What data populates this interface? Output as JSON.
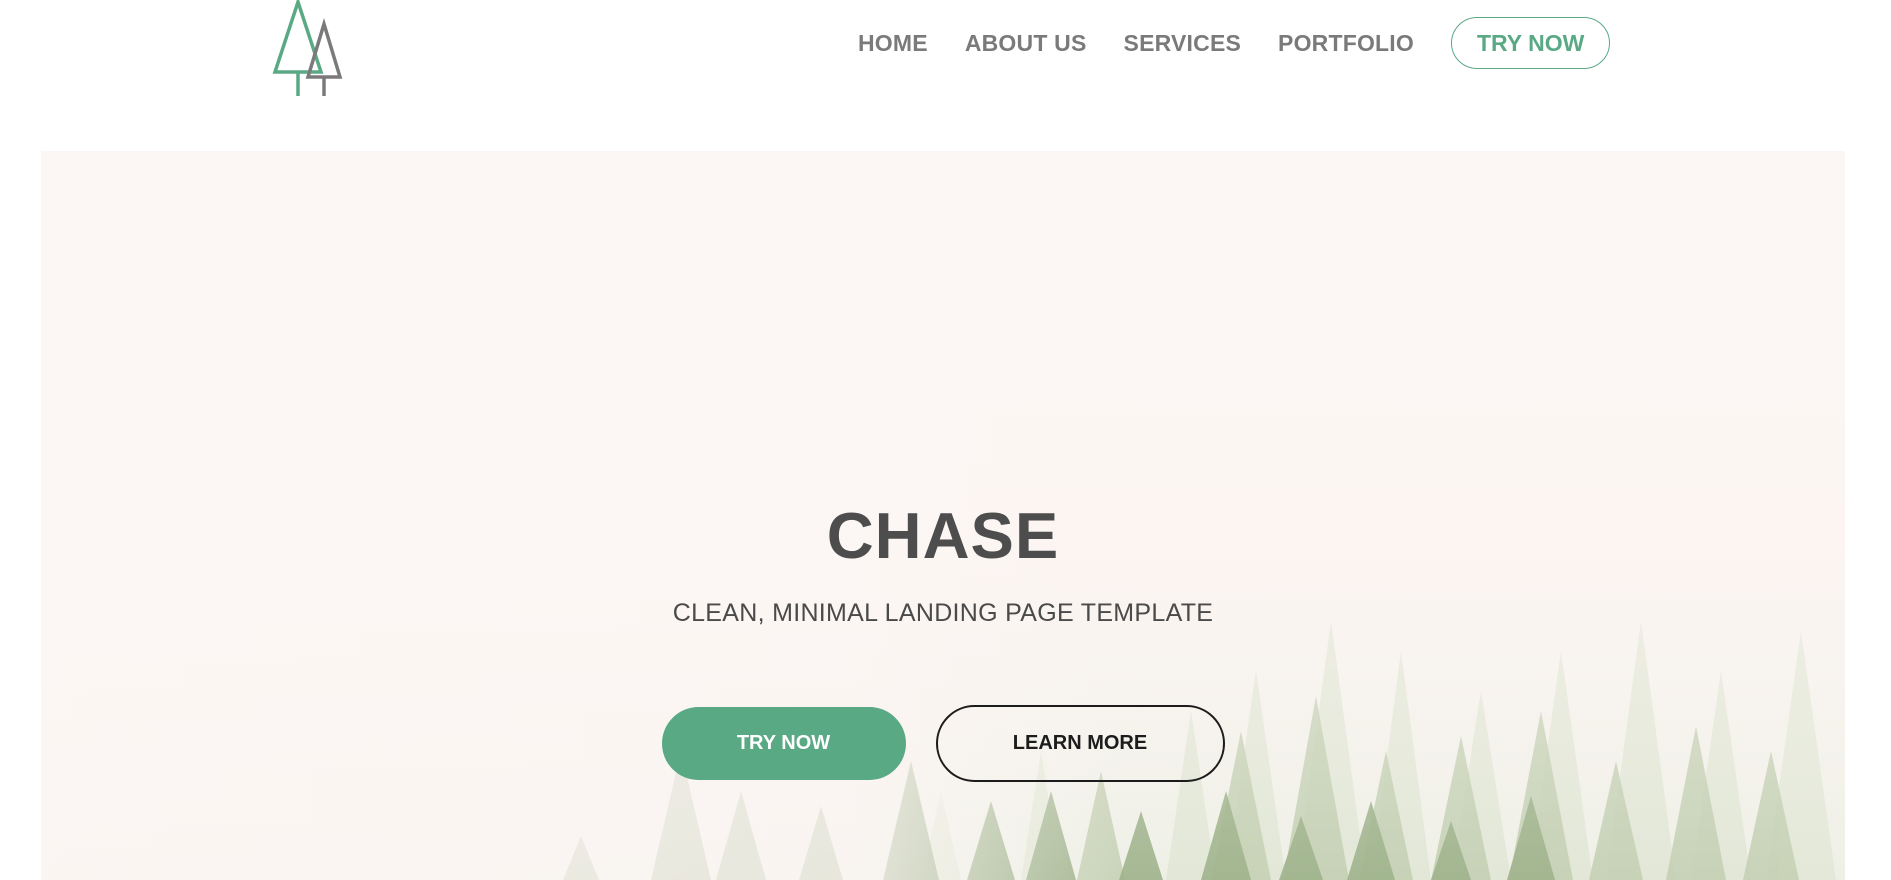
{
  "header": {
    "logo": {
      "icon": "twin-pine-trees-logo",
      "colors": {
        "front_tree": "#5aa985",
        "back_tree": "#7a7a7a"
      }
    },
    "nav": [
      {
        "label": "HOME"
      },
      {
        "label": "ABOUT US"
      },
      {
        "label": "SERVICES"
      },
      {
        "label": "PORTFOLIO"
      }
    ],
    "cta_label": "TRY NOW"
  },
  "hero": {
    "background": "misty-forest-image",
    "title": "CHASE",
    "subtitle": "CLEAN, MINIMAL LANDING PAGE TEMPLATE",
    "primary_button_label": "TRY NOW",
    "secondary_button_label": "LEARN MORE"
  },
  "colors": {
    "accent": "#5aa985",
    "nav_text": "#7a7a7a",
    "hero_background": "#fcf6f4",
    "heading_text": "#4d4d4d"
  }
}
